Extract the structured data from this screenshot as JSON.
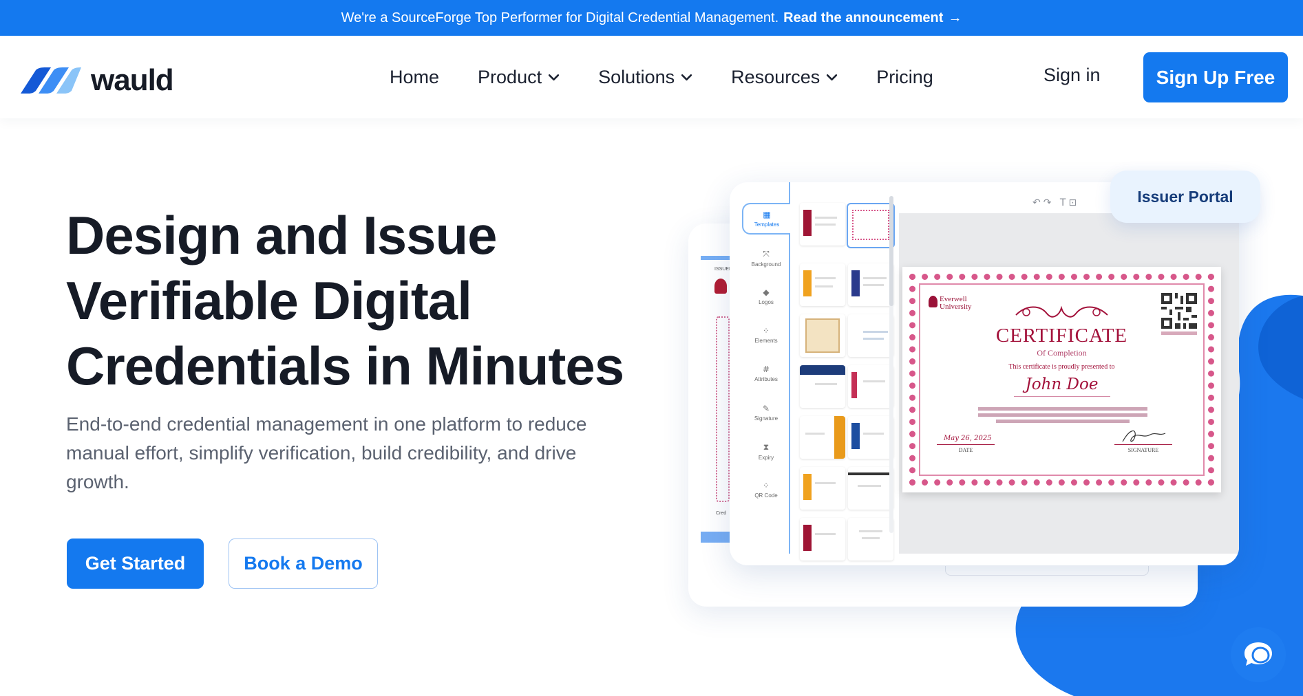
{
  "announcement": {
    "text": "We're a SourceForge Top Performer for Digital Credential Management.",
    "link": "Read the announcement",
    "arrow": "→"
  },
  "header": {
    "brand": "wauld",
    "nav": [
      {
        "label": "Home",
        "dropdown": false
      },
      {
        "label": "Product",
        "dropdown": true
      },
      {
        "label": "Solutions",
        "dropdown": true
      },
      {
        "label": "Resources",
        "dropdown": true
      },
      {
        "label": "Pricing",
        "dropdown": false
      }
    ],
    "sign_in": "Sign in",
    "sign_up": "Sign Up Free"
  },
  "hero": {
    "title_lines": [
      "Design and Issue",
      "Verifiable Digital",
      "Credentials in Minutes"
    ],
    "subtitle": "End-to-end credential management in one platform to reduce manual effort, simplify verification, build credibility, and drive growth.",
    "cta_primary": "Get Started",
    "cta_secondary": "Book a Demo"
  },
  "editor": {
    "tabs": [
      {
        "label": "Templates",
        "icon": "templates-icon",
        "active": true
      },
      {
        "label": "Background",
        "icon": "background-icon",
        "active": false
      },
      {
        "label": "Logos",
        "icon": "logos-icon",
        "active": false
      },
      {
        "label": "Elements",
        "icon": "elements-icon",
        "active": false
      },
      {
        "label": "Attributes",
        "icon": "attributes-icon",
        "active": false
      },
      {
        "label": "Signature",
        "icon": "signature-icon",
        "active": false
      },
      {
        "label": "Expiry",
        "icon": "expiry-icon",
        "active": false
      },
      {
        "label": "QR Code",
        "icon": "qr-code-icon",
        "active": false
      }
    ],
    "back_card_label": "ISSUER",
    "back_card_footer": "Cred",
    "issuer_portal": "Issuer Portal"
  },
  "certificate": {
    "university": [
      "Everwell",
      "University"
    ],
    "title": "CERTIFICATE",
    "subtitle": "Of Completion",
    "presented": "This certificate is proudly presented to",
    "name": "John Doe",
    "date_value": "May 26, 2025",
    "date_label": "DATE",
    "signature_label": "SIGNATURE"
  },
  "colors": {
    "brand_blue": "#1479ef",
    "certificate_red": "#a3123b",
    "certificate_pink": "#d7578a"
  }
}
